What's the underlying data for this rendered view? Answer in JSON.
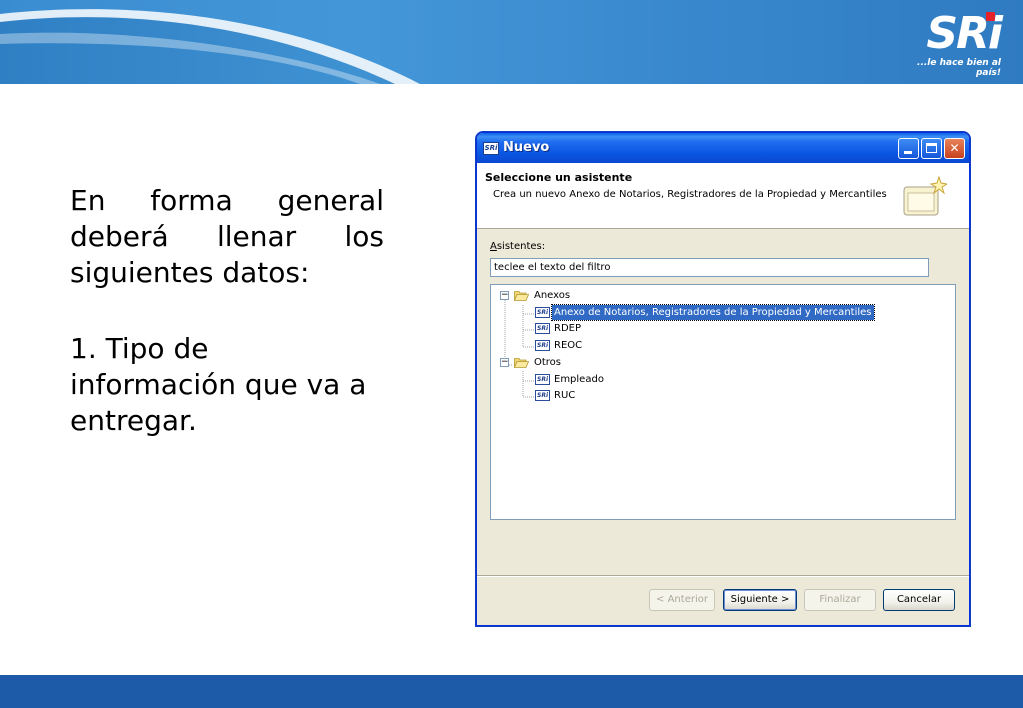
{
  "logo": {
    "text": "SRi",
    "tagline": "...le hace bien al país!"
  },
  "slide": {
    "paragraph1": "En forma general deberá llenar los siguientes datos:",
    "item1_line1": "1.  Tipo de",
    "item1_line2": "información que va a",
    "item1_line3": "entregar."
  },
  "dialog": {
    "title": "Nuevo",
    "title_icon": "SRi",
    "header_title": "Seleccione un asistente",
    "header_desc": "Crea un nuevo Anexo de Notarios, Registradores de la Propiedad y Mercantiles",
    "asistentes_label_key": "A",
    "asistentes_label_rest": "sistentes:",
    "filter_value": "teclee el texto del filtro",
    "tree": {
      "group1": "Anexos",
      "group1_items": [
        "Anexo de Notarios, Registradores de la Propiedad y Mercantiles",
        "RDEP",
        "REOC"
      ],
      "group2": "Otros",
      "group2_items": [
        "Empleado",
        "RUC"
      ]
    },
    "buttons": {
      "anterior": "< Anterior",
      "siguiente": "Siguiente >",
      "finalizar": "Finalizar",
      "cancelar": "Cancelar"
    }
  },
  "colors": {
    "banner": "#2f7fc4",
    "footer": "#1d5aa8",
    "selection": "#316ac5",
    "logo_dot": "#e5212b"
  }
}
